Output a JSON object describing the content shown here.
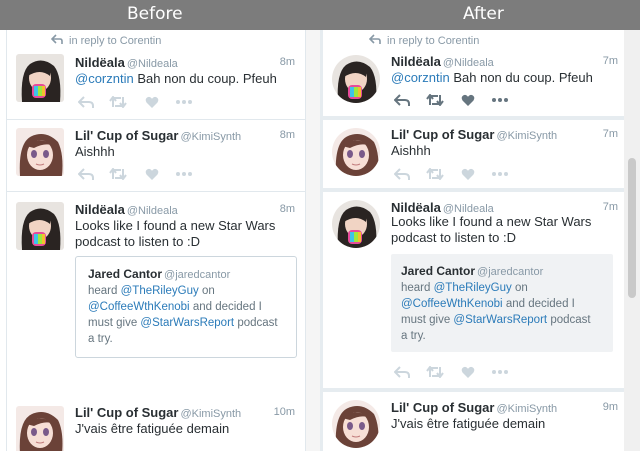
{
  "headers": {
    "before": "Before",
    "after": "After"
  },
  "tweets": [
    {
      "reply_to": "in reply to Corentin",
      "name": "Nildëala",
      "handle": "@Nildeala",
      "time_before": "8m",
      "time_after": "7m",
      "text_mention": "@corzntin",
      "text": "Bah non du coup. Pfeuh"
    },
    {
      "name": "Lil' Cup of Sugar",
      "handle": "@KimiSynth",
      "time_before": "8m",
      "time_after": "7m",
      "text": "Aishhh"
    },
    {
      "name": "Nildëala",
      "handle": "@Nildeala",
      "time_before": "8m",
      "time_after": "7m",
      "text_line1": "Looks like I found a new Star Wars",
      "text_line2": "podcast to listen to :D",
      "quote": {
        "name": "Jared Cantor",
        "handle": "@jaredcantor",
        "heard": "heard",
        "mention1": "@TheRileyGuy",
        "on": "on",
        "mention2": "@CoffeeWthKenobi",
        "and_decided": "and decided I",
        "must_give": "must give",
        "mention3": "@StarWarsReport",
        "podcast": "podcast",
        "try": "a try."
      }
    },
    {
      "name": "Lil' Cup of Sugar",
      "handle": "@KimiSynth",
      "time_before": "10m",
      "time_after": "9m",
      "text": "J'vais être fatiguée demain"
    }
  ],
  "icons": [
    "reply-icon",
    "retweet-icon",
    "like-icon",
    "more-icon"
  ],
  "colors": {
    "header_bg": "#7c7c7c",
    "mention": "#2b7bb9",
    "muted": "#8899a6",
    "after_bg": "#e6ecf0",
    "icon_before": "#ccd6dd",
    "icon_after_active": "#66757f"
  }
}
